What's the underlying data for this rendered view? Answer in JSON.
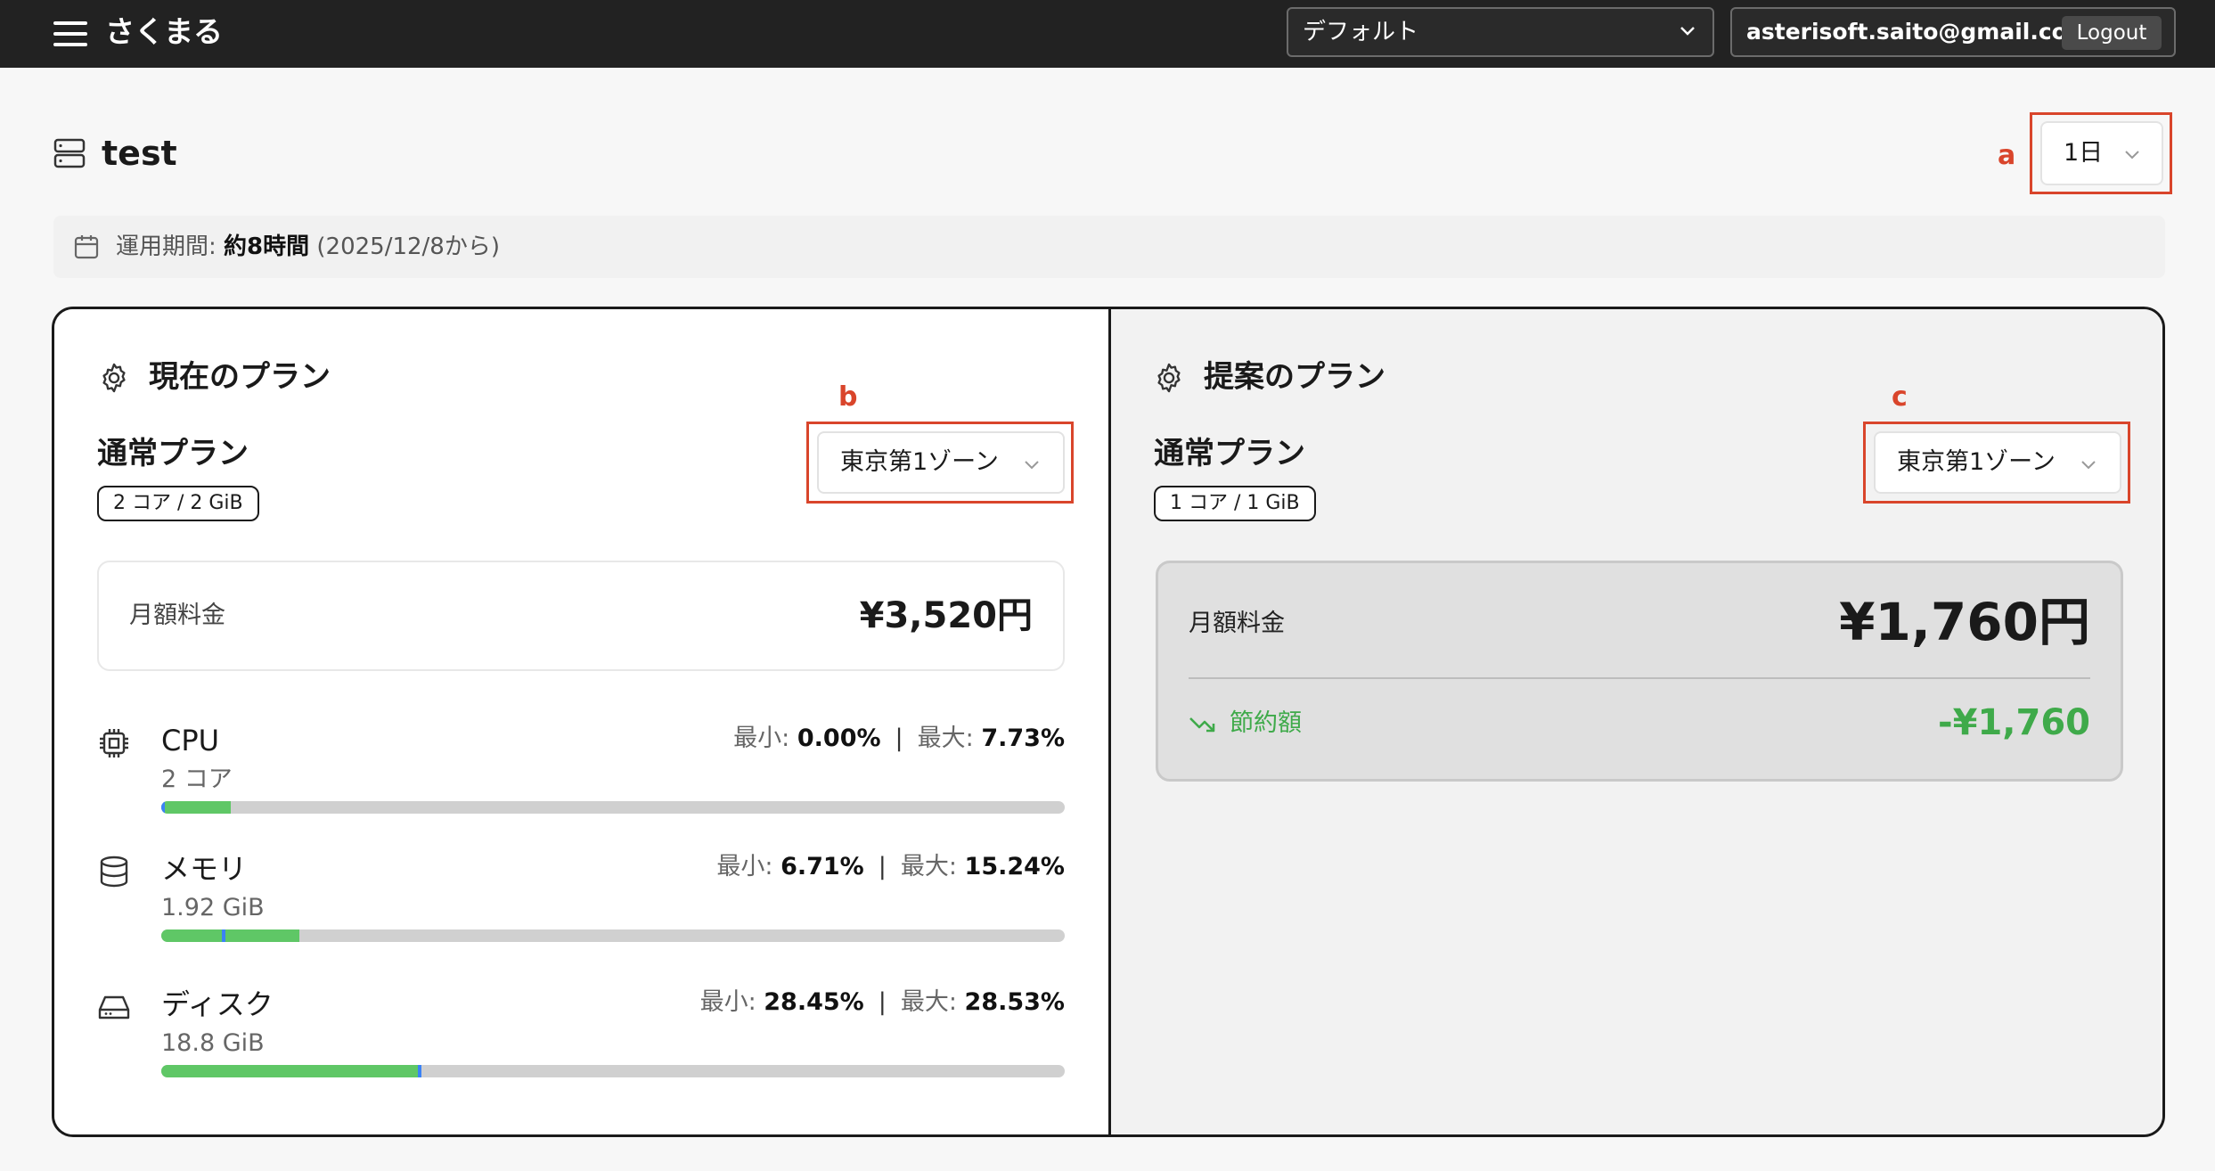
{
  "header": {
    "brand": "さくまる",
    "workspace_select": "デフォルト",
    "user_email": "asterisoft.saito@gmail.com",
    "logout_label": "Logout"
  },
  "page": {
    "title": "test",
    "period_select": "1日"
  },
  "annotations": {
    "a": "a",
    "b": "b",
    "c": "c"
  },
  "operation": {
    "label": "運用期間: ",
    "value": "約8時間",
    "since": "(2025/12/8から)"
  },
  "current_plan": {
    "heading": "現在のプラン",
    "plan_name": "通常プラン",
    "spec": "2 コア / 2 GiB",
    "zone": "東京第1ゾーン",
    "monthly_label": "月額料金",
    "monthly_price": "¥3,520円",
    "resources": [
      {
        "name": "CPU",
        "sub": "2 コア",
        "min_label": "最小: ",
        "min": "0.00%",
        "max_label": "最大: ",
        "max": "7.73%",
        "min_frac": 0.0,
        "max_frac": 0.0773
      },
      {
        "name": "メモリ",
        "sub": "1.92 GiB",
        "min_label": "最小: ",
        "min": "6.71%",
        "max_label": "最大: ",
        "max": "15.24%",
        "min_frac": 0.0671,
        "max_frac": 0.1524
      },
      {
        "name": "ディスク",
        "sub": "18.8 GiB",
        "min_label": "最小: ",
        "min": "28.45%",
        "max_label": "最大: ",
        "max": "28.53%",
        "min_frac": 0.2845,
        "max_frac": 0.2853
      }
    ]
  },
  "proposed_plan": {
    "heading": "提案のプラン",
    "plan_name": "通常プラン",
    "spec": "1 コア / 1 GiB",
    "zone": "東京第1ゾーン",
    "monthly_label": "月額料金",
    "monthly_price": "¥1,760円",
    "savings_label": "節約額",
    "savings_value": "-¥1,760"
  },
  "colors": {
    "header_bg": "#222222",
    "annotation": "#d9452b",
    "bar_fill": "#5fc766",
    "bar_marker": "#3b82f6",
    "savings": "#3faa4a"
  }
}
